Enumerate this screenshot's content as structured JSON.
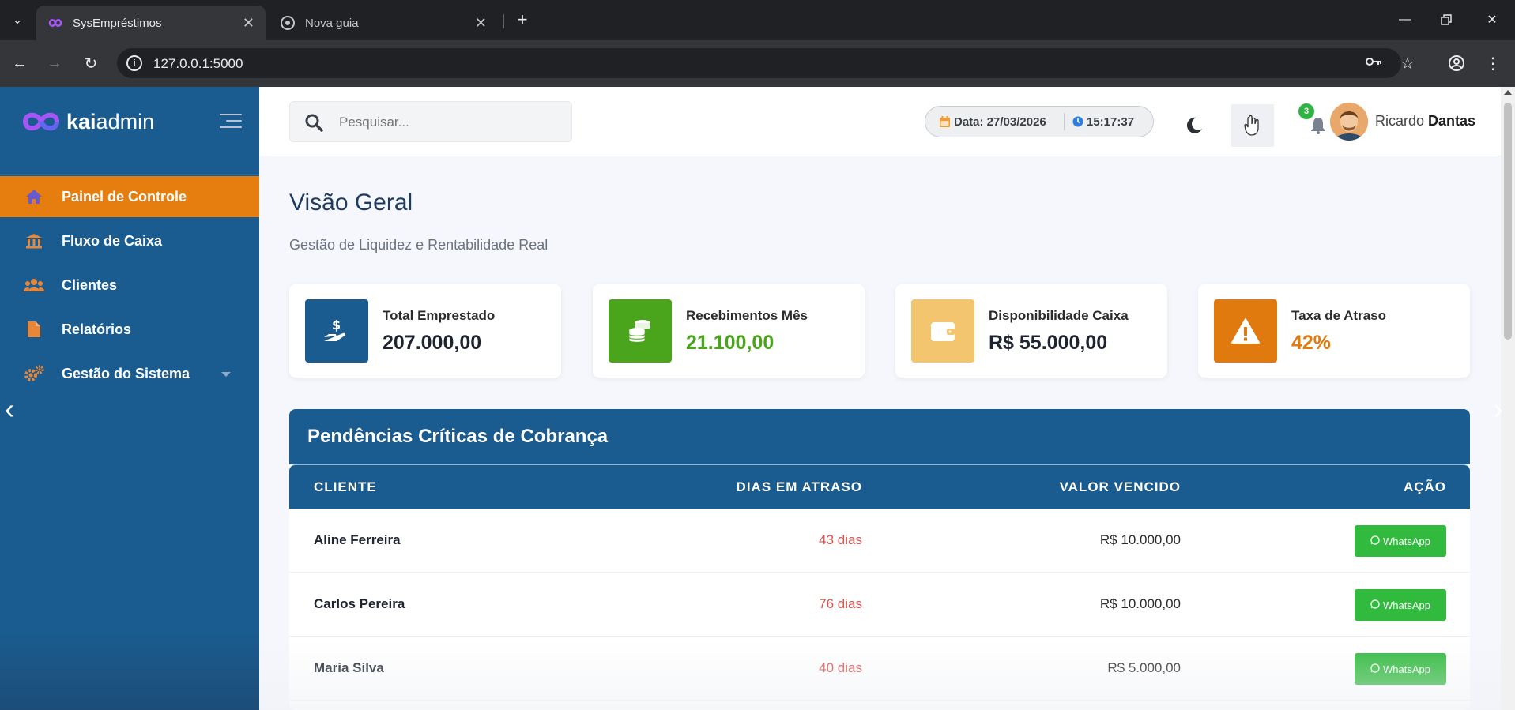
{
  "browser": {
    "tabs": [
      {
        "title": "SysEmpréstimos",
        "active": true
      },
      {
        "title": "Nova guia",
        "active": false
      }
    ],
    "url": "127.0.0.1:5000"
  },
  "sidebar": {
    "logo_prefix": "kai",
    "logo_suffix": "admin",
    "items": [
      {
        "label": "Painel de Controle",
        "icon": "home-icon",
        "active": true
      },
      {
        "label": "Fluxo de Caixa",
        "icon": "bank-icon",
        "active": false
      },
      {
        "label": "Clientes",
        "icon": "users-icon",
        "active": false
      },
      {
        "label": "Relatórios",
        "icon": "file-icon",
        "active": false
      },
      {
        "label": "Gestão do Sistema",
        "icon": "cogs-icon",
        "active": false
      }
    ]
  },
  "header": {
    "search_placeholder": "Pesquisar...",
    "date": "Data: 27/03/2026",
    "time": "15:17:37",
    "notifications_count": "3",
    "user_first": "Ricardo",
    "user_last": "Dantas"
  },
  "page": {
    "title": "Visão Geral",
    "subtitle": "Gestão de Liquidez e Rentabilidade Real"
  },
  "cards": [
    {
      "label": "Total Emprestado",
      "value": "207.000,00",
      "icon": "hand-holding-dollar-icon",
      "color": "#1a5c8f",
      "value_color": "#1f2430"
    },
    {
      "label": "Recebimentos Mês",
      "value": "21.100,00",
      "icon": "coins-icon",
      "color": "#4aa51c",
      "value_color": "#4aa51c"
    },
    {
      "label": "Disponibilidade Caixa",
      "value": "R$ 55.000,00",
      "icon": "wallet-icon",
      "color": "#f4c56f",
      "value_color": "#1f2430"
    },
    {
      "label": "Taxa de Atraso",
      "value": "42%",
      "icon": "warning-icon",
      "color": "#e07a0e",
      "value_color": "#e07a0e"
    }
  ],
  "pending": {
    "title": "Pendências Críticas de Cobrança",
    "columns": [
      "CLIENTE",
      "DIAS EM ATRASO",
      "VALOR VENCIDO",
      "AÇÃO"
    ],
    "rows": [
      {
        "client": "Aline Ferreira",
        "days": "43 dias",
        "amount": "R$ 10.000,00",
        "action": "WhatsApp"
      },
      {
        "client": "Carlos Pereira",
        "days": "76 dias",
        "amount": "R$ 10.000,00",
        "action": "WhatsApp"
      },
      {
        "client": "Maria Silva",
        "days": "40 dias",
        "amount": "R$ 5.000,00",
        "action": "WhatsApp"
      }
    ]
  }
}
